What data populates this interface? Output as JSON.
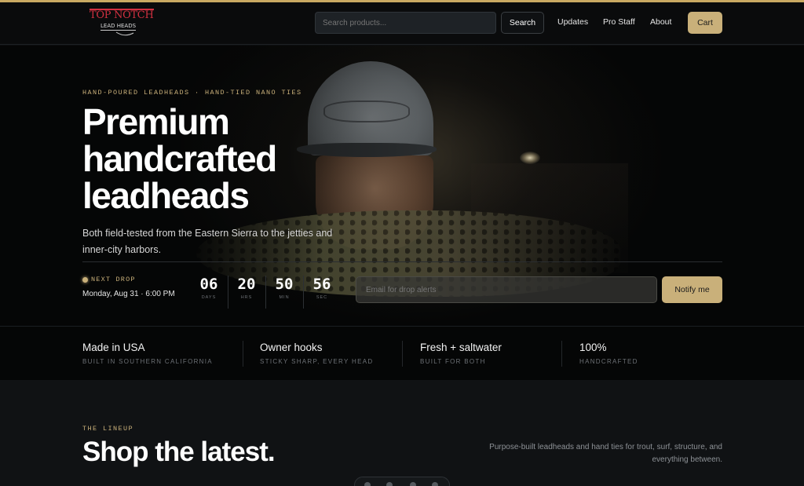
{
  "header": {
    "logo_top": "TOP NOTCH",
    "logo_bottom": "LEAD HEADS",
    "search_placeholder": "Search products...",
    "search_button": "Search",
    "nav": [
      "Updates",
      "Pro Staff",
      "About"
    ],
    "cart": "Cart"
  },
  "hero": {
    "eyebrow": "HAND-POURED LEADHEADS · HAND-TIED NANO TIES",
    "title": "Premium handcrafted leadheads",
    "subtitle": "Both field-tested from the Eastern Sierra to the jetties and inner-city harbors.",
    "drop_label": "NEXT DROP",
    "drop_date": "Monday, Aug 31 · 6:00 PM",
    "countdown": [
      {
        "value": "06",
        "unit": "DAYS"
      },
      {
        "value": "20",
        "unit": "HRS"
      },
      {
        "value": "50",
        "unit": "MIN"
      },
      {
        "value": "56",
        "unit": "SEC"
      }
    ],
    "email_placeholder": "Email for drop alerts",
    "notify_button": "Notify me"
  },
  "features": [
    {
      "title": "Made in USA",
      "sub": "BUILT IN SOUTHERN CALIFORNIA"
    },
    {
      "title": "Owner hooks",
      "sub": "STICKY SHARP, EVERY HEAD"
    },
    {
      "title": "Fresh + saltwater",
      "sub": "BUILT FOR BOTH"
    },
    {
      "title": "100%",
      "sub": "HANDCRAFTED"
    }
  ],
  "lineup": {
    "eyebrow": "THE LINEUP",
    "title": "Shop the latest.",
    "description": "Purpose-built leadheads and hand ties for trout, surf, structure, and everything between."
  },
  "colors": {
    "accent": "#c9b07a",
    "background": "#0d0f11",
    "logo_red": "#d13040"
  }
}
